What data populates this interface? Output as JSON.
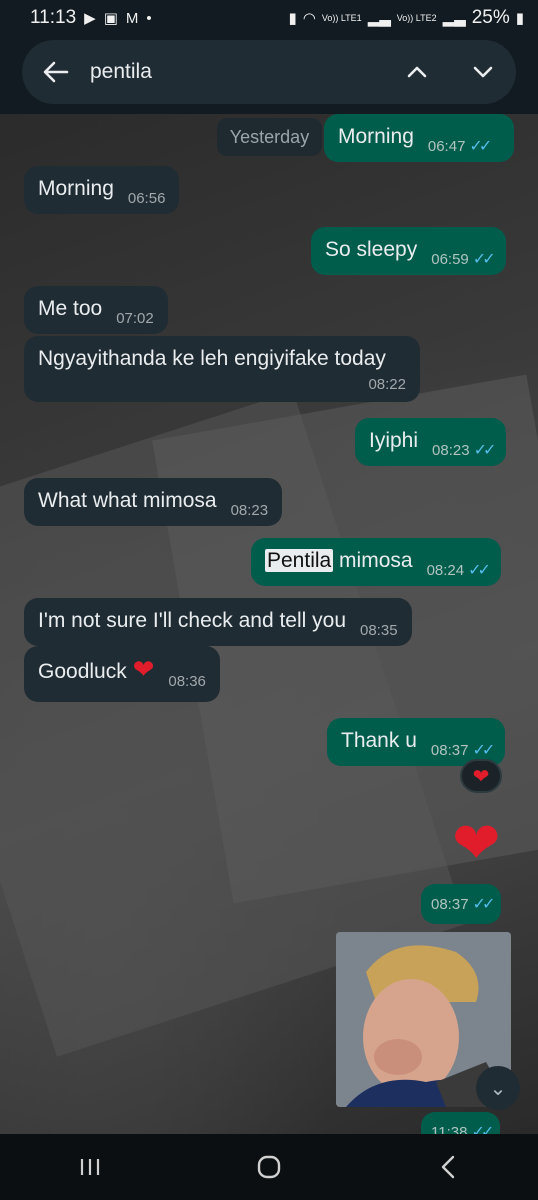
{
  "status_bar": {
    "time": "11:13",
    "left_icons": [
      "play-icon",
      "gallery-icon",
      "gmail-icon",
      "dot-icon"
    ],
    "network1": "Vo)) LTE1",
    "network2": "Vo)) LTE2",
    "battery": "25%"
  },
  "search": {
    "query": "pentila"
  },
  "chat": {
    "date_chip": "Yesterday",
    "messages": [
      {
        "dir": "out",
        "text": "Morning",
        "time": "06:47"
      },
      {
        "dir": "in",
        "text": "Morning",
        "time": "06:56"
      },
      {
        "dir": "out",
        "text": "So sleepy",
        "time": "06:59"
      },
      {
        "dir": "in",
        "text": "Me too",
        "time": "07:02"
      },
      {
        "dir": "in",
        "text": "Ngyayithanda ke leh engiyifake today",
        "time": "08:22"
      },
      {
        "dir": "out",
        "text": "Iyiphi",
        "time": "08:23"
      },
      {
        "dir": "in",
        "text": "What what mimosa",
        "time": "08:23"
      },
      {
        "dir": "out",
        "text_highlight": "Pentila",
        "text": " mimosa",
        "time": "08:24"
      },
      {
        "dir": "in",
        "text": "I'm not sure I'll check and tell you",
        "time": "08:35"
      },
      {
        "dir": "in",
        "text": "Goodluck",
        "time": "08:36",
        "emoji": "❤"
      },
      {
        "dir": "out",
        "text": "Thank u",
        "time": "08:37",
        "reaction": "❤"
      },
      {
        "dir": "out",
        "emoji": "❤",
        "time": "08:37"
      },
      {
        "dir": "out",
        "sticker": "sticker-image",
        "time": "11:38"
      }
    ]
  },
  "colors": {
    "outgoing_bubble": "#005c4b",
    "incoming_bubble": "#202c33",
    "read_ticks": "#53bdeb",
    "heart": "#e11d2b"
  },
  "nav_bar": [
    "recents-icon",
    "home-icon",
    "back-icon"
  ]
}
